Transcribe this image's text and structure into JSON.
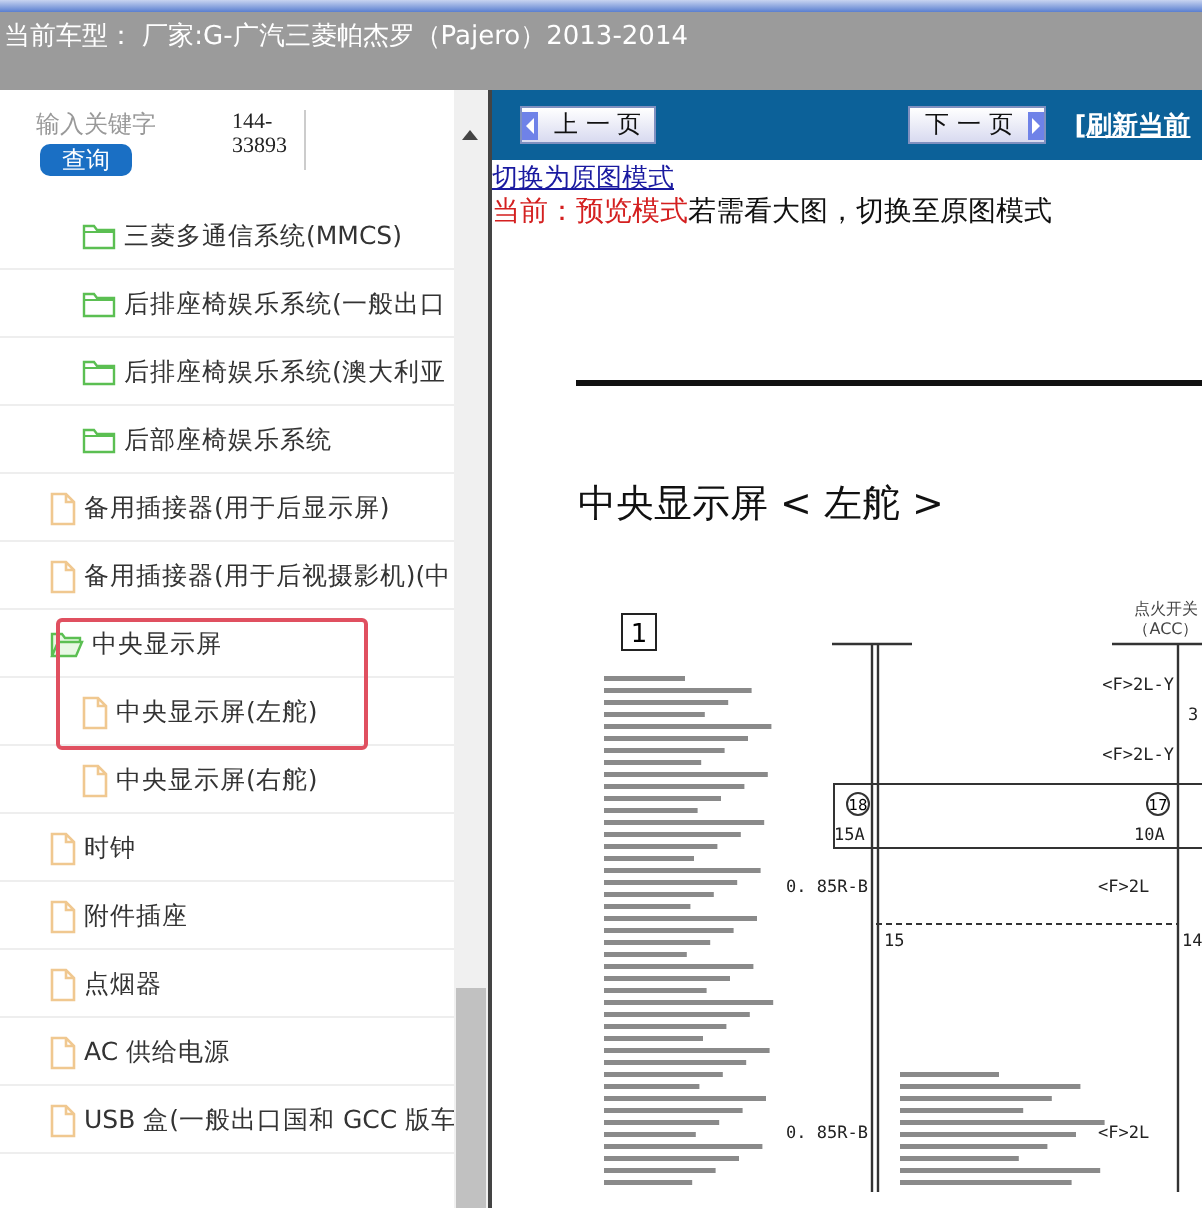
{
  "header": {
    "car_model": "当前车型：  厂家:G-广汽三菱帕杰罗（Pajero）2013-2014"
  },
  "search": {
    "placeholder": "输入关键字",
    "value": "144-33893",
    "button": "查询"
  },
  "tree": [
    {
      "children": [
        {
          "kind": "folder",
          "label": "三菱多通信系统(MMCS)",
          "expanded": false,
          "highlighted": false
        },
        {
          "kind": "folder",
          "label": "后排座椅娱乐系统(一般出口",
          "expanded": false,
          "highlighted": false
        },
        {
          "kind": "folder",
          "label": "后排座椅娱乐系统(澳大利亚",
          "expanded": false,
          "highlighted": false
        },
        {
          "kind": "folder",
          "label": "后部座椅娱乐系统",
          "expanded": false,
          "highlighted": false
        }
      ]
    },
    {
      "kind": "file",
      "label": "备用插接器(用于后显示屏)"
    },
    {
      "kind": "file",
      "label": "备用插接器(用于后视摄影机)(中"
    },
    {
      "kind": "folder",
      "label": "中央显示屏",
      "expanded": true,
      "highlighted": true,
      "children": [
        {
          "kind": "file",
          "label": "中央显示屏(左舵)"
        },
        {
          "kind": "file",
          "label": "中央显示屏(右舵)"
        }
      ]
    },
    {
      "kind": "file",
      "label": "时钟"
    },
    {
      "kind": "file",
      "label": "附件插座"
    },
    {
      "kind": "file",
      "label": "点烟器"
    },
    {
      "kind": "file",
      "label": "AC 供给电源"
    },
    {
      "kind": "file",
      "label": "USB 盒(一般出口国和 GCC 版车"
    }
  ],
  "pager": {
    "prev": "上 一 页",
    "next": "下 一 页",
    "refresh": "[刷新当前"
  },
  "mode": {
    "switch_link": "切换为原图模式",
    "current": "当前：预览模式",
    "hint": "若需看大图，切换至原图模式"
  },
  "document": {
    "title": "中央显示屏 < 左舵 >",
    "section_number": "1",
    "ignition_switch": [
      "点火开关",
      "（ACC）"
    ],
    "labels": [
      "<F>2L-Y",
      "3",
      "<F>2L-Y",
      "15A",
      "10A",
      "0. 85R-B",
      "<F>2L",
      "15",
      "14",
      "0. 85R-B",
      "<F>2L"
    ],
    "fuses": [
      "18",
      "17"
    ]
  }
}
